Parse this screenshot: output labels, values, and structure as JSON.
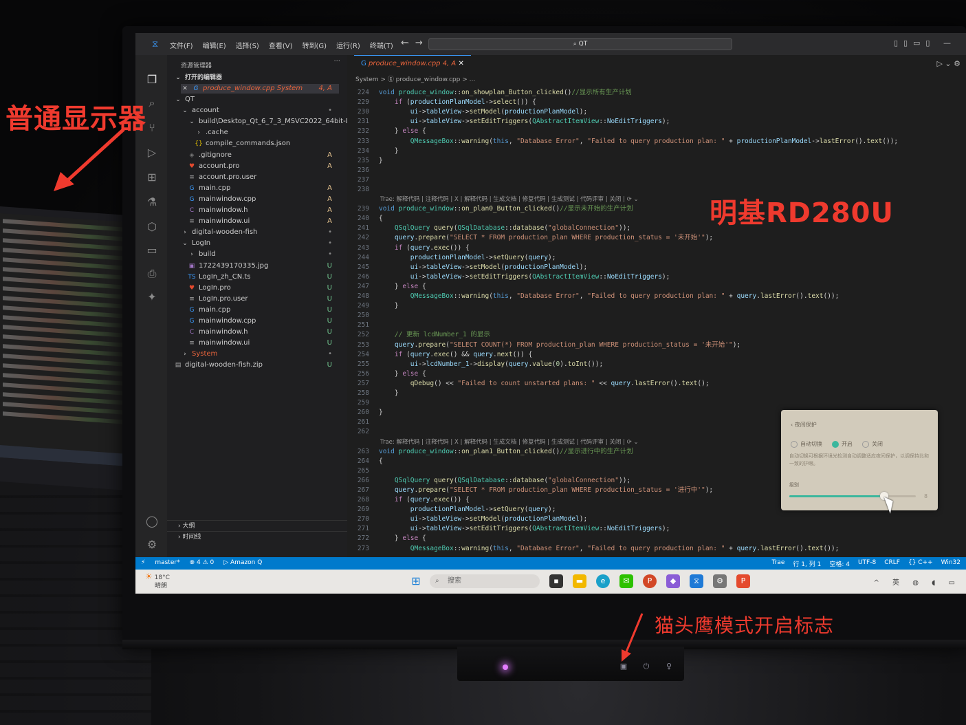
{
  "annotations": {
    "normal_monitor": "普通显示器",
    "monitor_model": "明基RD280U",
    "owl_mode": "猫头鹰模式开启标志"
  },
  "titlebar": {
    "menu": [
      "文件(F)",
      "编辑(E)",
      "选择(S)",
      "查看(V)",
      "转到(G)",
      "运行(R)",
      "终端(T)",
      "···"
    ],
    "search": "⌕ QT"
  },
  "sidebar": {
    "header": "资源管理器",
    "open_editors": "打开的编辑器",
    "open_file": "produce_window.cpp System",
    "open_file_badge": "4, A",
    "items": [
      {
        "label": "QT",
        "indent": 0,
        "ic": "⌄",
        "badge": ""
      },
      {
        "label": "account",
        "indent": 1,
        "ic": "⌄",
        "badge": "•"
      },
      {
        "label": "build\\Desktop_Qt_6_7_3_MSVC2022_64bit-Debug\\...",
        "indent": 2,
        "ic": "⌄",
        "badge": ""
      },
      {
        "label": ".cache",
        "indent": 3,
        "ic": "›",
        "badge": ""
      },
      {
        "label": "compile_commands.json",
        "indent": 3,
        "ic": "{}",
        "badge": ""
      },
      {
        "label": ".gitignore",
        "indent": 2,
        "ic": "◈",
        "badge": "A"
      },
      {
        "label": "account.pro",
        "indent": 2,
        "ic": "♥",
        "badge": "A"
      },
      {
        "label": "account.pro.user",
        "indent": 2,
        "ic": "≡",
        "badge": ""
      },
      {
        "label": "main.cpp",
        "indent": 2,
        "ic": "G",
        "badge": "A"
      },
      {
        "label": "mainwindow.cpp",
        "indent": 2,
        "ic": "G",
        "badge": "A"
      },
      {
        "label": "mainwindow.h",
        "indent": 2,
        "ic": "C",
        "badge": "A"
      },
      {
        "label": "mainwindow.ui",
        "indent": 2,
        "ic": "≡",
        "badge": "A"
      },
      {
        "label": "digital-wooden-fish",
        "indent": 1,
        "ic": "›",
        "badge": "•"
      },
      {
        "label": "LogIn",
        "indent": 1,
        "ic": "⌄",
        "badge": "•"
      },
      {
        "label": "build",
        "indent": 2,
        "ic": "›",
        "badge": "•"
      },
      {
        "label": "1722439170335.jpg",
        "indent": 2,
        "ic": "▣",
        "badge": "U"
      },
      {
        "label": "LogIn_zh_CN.ts",
        "indent": 2,
        "ic": "TS",
        "badge": "U"
      },
      {
        "label": "LogIn.pro",
        "indent": 2,
        "ic": "♥",
        "badge": "U"
      },
      {
        "label": "LogIn.pro.user",
        "indent": 2,
        "ic": "≡",
        "badge": "U"
      },
      {
        "label": "main.cpp",
        "indent": 2,
        "ic": "G",
        "badge": "U"
      },
      {
        "label": "mainwindow.cpp",
        "indent": 2,
        "ic": "G",
        "badge": "U"
      },
      {
        "label": "mainwindow.h",
        "indent": 2,
        "ic": "C",
        "badge": "U"
      },
      {
        "label": "mainwindow.ui",
        "indent": 2,
        "ic": "≡",
        "badge": "U"
      },
      {
        "label": "System",
        "indent": 1,
        "ic": "›",
        "badge": "•",
        "highlight": true
      },
      {
        "label": "digital-wooden-fish.zip",
        "indent": 0,
        "ic": "▤",
        "badge": "U"
      }
    ],
    "outline": "大纲",
    "timeline": "时间线"
  },
  "editor": {
    "tab": "produce_window.cpp 4, A",
    "breadcrumb": "System > ⓖ produce_window.cpp > ...",
    "lens": "Trae: 解释代码 | 注释代码 | X | 解释代码 | 生成文档 | 修复代码 | 生成测试 | 代码评审 | 关闭 | ⟳ ⌄"
  },
  "statusbar": {
    "left": [
      "master*",
      "⊗ 4 ⚠ 0",
      "▷ Amazon Q"
    ],
    "right": [
      "Trae",
      "行 1, 列 1",
      "空格: 4",
      "UTF-8",
      "CRLF",
      "{} C++",
      "Win32"
    ]
  },
  "taskbar": {
    "weather_temp": "18°C",
    "weather_desc": "晴朗",
    "search": "搜索",
    "tray": "^ 英"
  },
  "popup": {
    "title": "夜间保护",
    "options": [
      "自动切换",
      "开启",
      "关闭"
    ],
    "selected": 1,
    "desc": "自动切换可根据环境光检测自动调整适应夜间保护，以调保持比和一致的护眼。",
    "level_label": "级别",
    "level_value": 0.75,
    "level_max": "8"
  },
  "colors": {
    "annotation": "#ef3a2e",
    "statusbar": "#007acc",
    "accent": "#3bb79d"
  }
}
